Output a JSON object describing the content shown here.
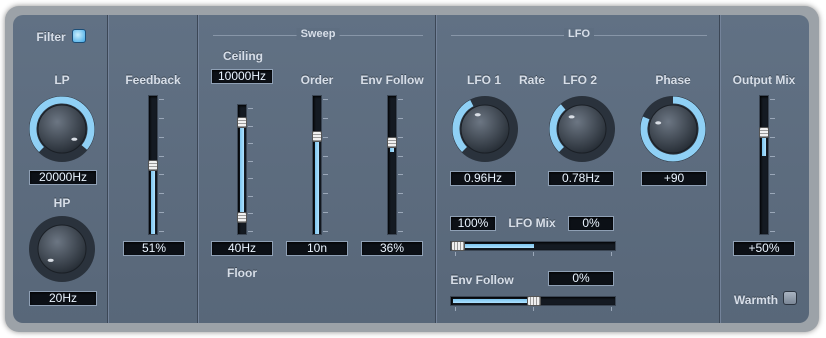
{
  "filter": {
    "label": "Filter",
    "on": true,
    "lp_label": "LP",
    "lp_value": "20000Hz",
    "lp_level": 0.98,
    "hp_label": "HP",
    "hp_value": "20Hz",
    "hp_level": 0.0
  },
  "feedback": {
    "label": "Feedback",
    "value": "51%",
    "level": 0.51
  },
  "sweep": {
    "title": "Sweep",
    "ceiling_label": "Ceiling",
    "ceiling_value": "10000Hz",
    "floor_label": "Floor",
    "floor_value": "40Hz",
    "range_high": 0.88,
    "range_low": 0.13,
    "order_label": "Order",
    "order_value": "10n",
    "order_level": 0.72,
    "env_follow_label": "Env Follow",
    "env_follow_value": "36%",
    "env_follow_level": 0.68
  },
  "lfo": {
    "title": "LFO",
    "lfo1_label": "LFO 1",
    "rate_label": "Rate",
    "lfo2_label": "LFO 2",
    "phase_label": "Phase",
    "lfo1_value": "0.96Hz",
    "lfo1_level": 0.4,
    "lfo2_value": "0.78Hz",
    "lfo2_level": 0.35,
    "phase_value": "+90",
    "phase_level": 0.25,
    "mix_left": "100%",
    "mix_label": "LFO Mix",
    "mix_right": "0%",
    "mix_level": 0.5,
    "env_follow_label": "Env Follow",
    "env_follow_value": "0%",
    "env_follow_level": 0.5
  },
  "output": {
    "label": "Output Mix",
    "value": "+50%",
    "level": 0.75,
    "warmth_label": "Warmth",
    "warmth_on": false
  },
  "colors": {
    "accent": "#8fd0f5",
    "panel": "#5e6e81"
  }
}
